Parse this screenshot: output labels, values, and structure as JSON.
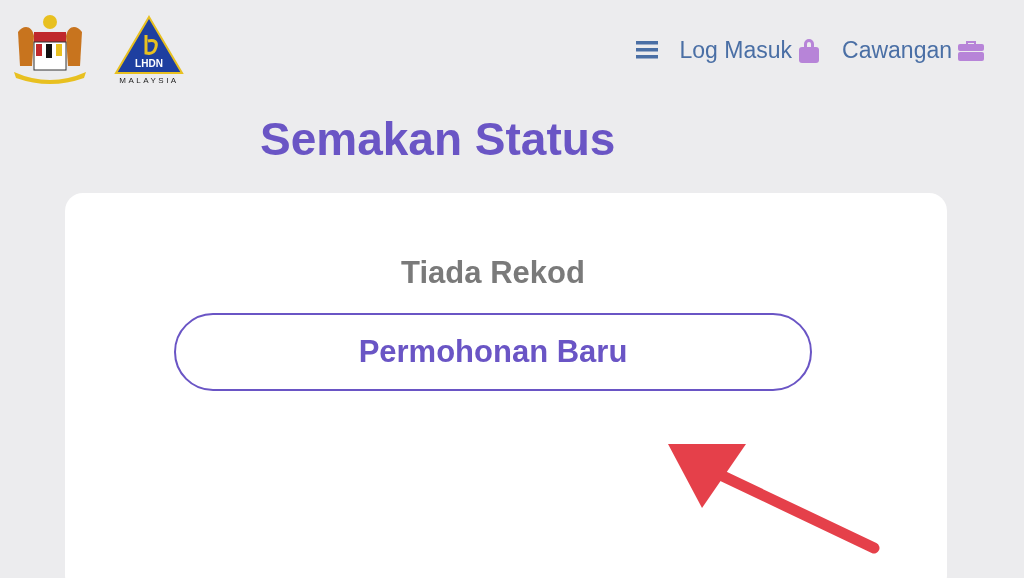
{
  "header": {
    "logo_text": "LHDN",
    "logo_subtext": "MALAYSIA",
    "nav": [
      {
        "label": "Log Masuk"
      },
      {
        "label": "Cawangan"
      }
    ]
  },
  "title": "Semakan Status",
  "card": {
    "message": "Tiada Rekod",
    "button": "Permohonan Baru"
  }
}
